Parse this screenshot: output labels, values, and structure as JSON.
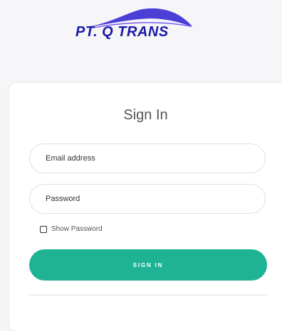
{
  "logo": {
    "text": "PT. Q TRANS",
    "colors": {
      "text": "#1a1aa6",
      "swoosh": "#4b3fd6"
    }
  },
  "login": {
    "title": "Sign In",
    "email_placeholder": "Email address",
    "password_placeholder": "Password",
    "show_password_label": "Show Password",
    "show_password_checked": false,
    "submit_label": "SIGN IN"
  },
  "colors": {
    "accent": "#1db394",
    "background": "#f6f6f8",
    "card": "#ffffff"
  }
}
